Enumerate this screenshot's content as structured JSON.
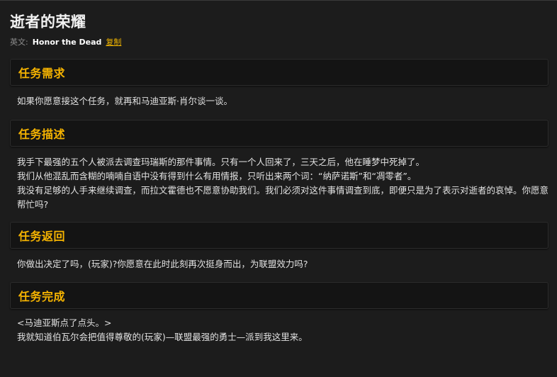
{
  "quest": {
    "title": "逝者的荣耀",
    "english_label": "英文:",
    "english_name": "Honor the Dead",
    "copy_label": "复制"
  },
  "sections": [
    {
      "title": "任务需求",
      "paragraphs": [
        "如果你愿意接这个任务，就再和马迪亚斯·肖尔谈一谈。"
      ]
    },
    {
      "title": "任务描述",
      "paragraphs": [
        "我手下最强的五个人被派去调查玛瑞斯的那件事情。只有一个人回来了，三天之后，他在睡梦中死掉了。",
        "我们从他混乱而含糊的喃喃自语中没有得到什么有用情报，只听出来两个词：“纳萨诺斯”和“凋零者”。",
        "我没有足够的人手来继续调查，而拉文霍德也不愿意协助我们。我们必须对这件事情调查到底，即便只是为了表示对逝者的哀悼。你愿意帮忙吗?"
      ]
    },
    {
      "title": "任务返回",
      "paragraphs": [
        "你做出决定了吗，(玩家)?你愿意在此时此刻再次挺身而出，为联盟效力吗?"
      ]
    },
    {
      "title": "任务完成",
      "paragraphs": [
        "<马迪亚斯点了点头。>",
        "我就知道伯瓦尔会把值得尊敬的(玩家)—联盟最强的勇士—派到我这里来。"
      ]
    }
  ]
}
